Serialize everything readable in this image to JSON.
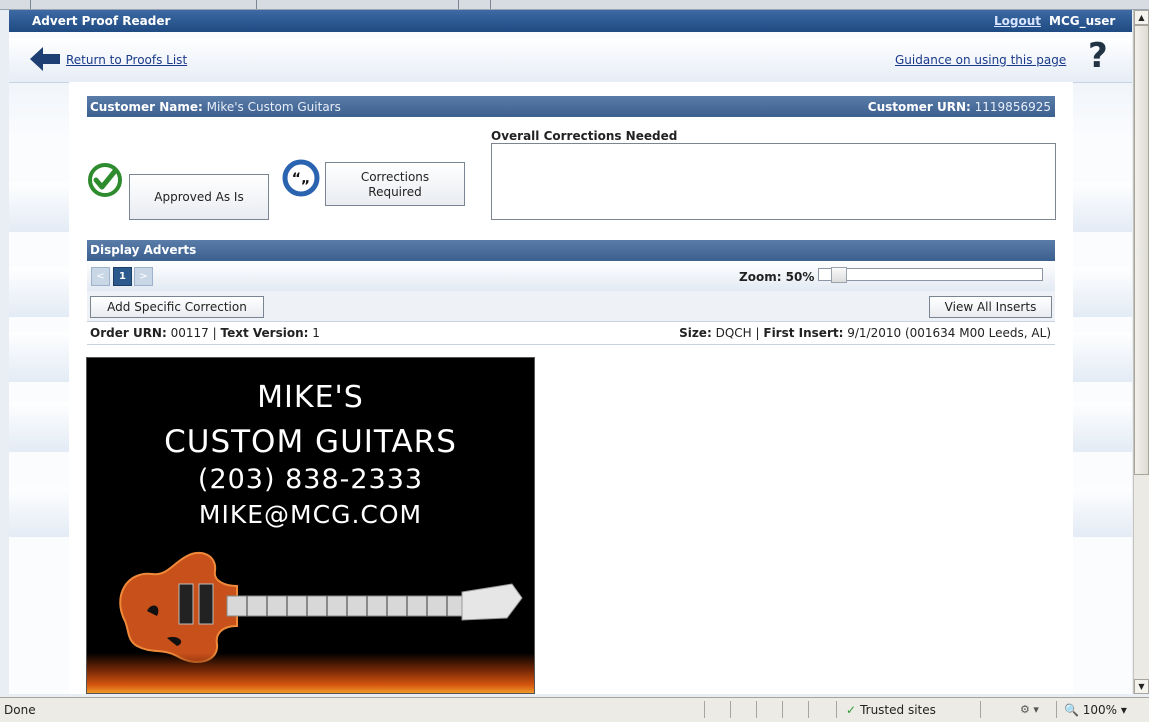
{
  "app": {
    "title": "Advert Proof Reader",
    "logout_label": "Logout",
    "username": "MCG_user"
  },
  "nav": {
    "return_label": "Return to Proofs List",
    "guidance_label": "Guidance on using this page",
    "help_glyph": "?"
  },
  "customer": {
    "name_label": "Customer Name:",
    "name_value": "Mike's Custom Guitars",
    "urn_label": "Customer URN:",
    "urn_value": "1119856925"
  },
  "decision": {
    "approved_label": "Approved As Is",
    "corrections_line1": "Corrections",
    "corrections_line2": "Required",
    "overall_label": "Overall Corrections Needed",
    "overall_value": ""
  },
  "display": {
    "section_title": "Display Adverts",
    "pager": {
      "prev": "<",
      "current": "1",
      "next": ">"
    },
    "zoom_label": "Zoom: 50%",
    "zoom_value": 0.5,
    "add_correction_label": "Add Specific Correction",
    "view_all_label": "View All Inserts"
  },
  "order": {
    "urn_label": "Order URN:",
    "urn_value": "00117",
    "sep": "|",
    "text_version_label": "Text Version:",
    "text_version_value": "1",
    "size_label": "Size:",
    "size_value": "DQCH",
    "first_insert_label": "First Insert:",
    "first_insert_value": "9/1/2010 (001634 M00 Leeds, AL)"
  },
  "advert": {
    "line1": "MIKE'S",
    "line2": "CUSTOM GUITARS",
    "line3": "(203) 838-2333",
    "line4": "MIKE@MCG.COM"
  },
  "status": {
    "left_text": "Done",
    "zone": "Trusted sites",
    "zoom": "100%"
  },
  "colors": {
    "header_bar": "#3b5f8f",
    "title_bar": "#1f4a82",
    "approve_green": "#2e8b2e",
    "corrections_blue": "#2a64b0"
  }
}
